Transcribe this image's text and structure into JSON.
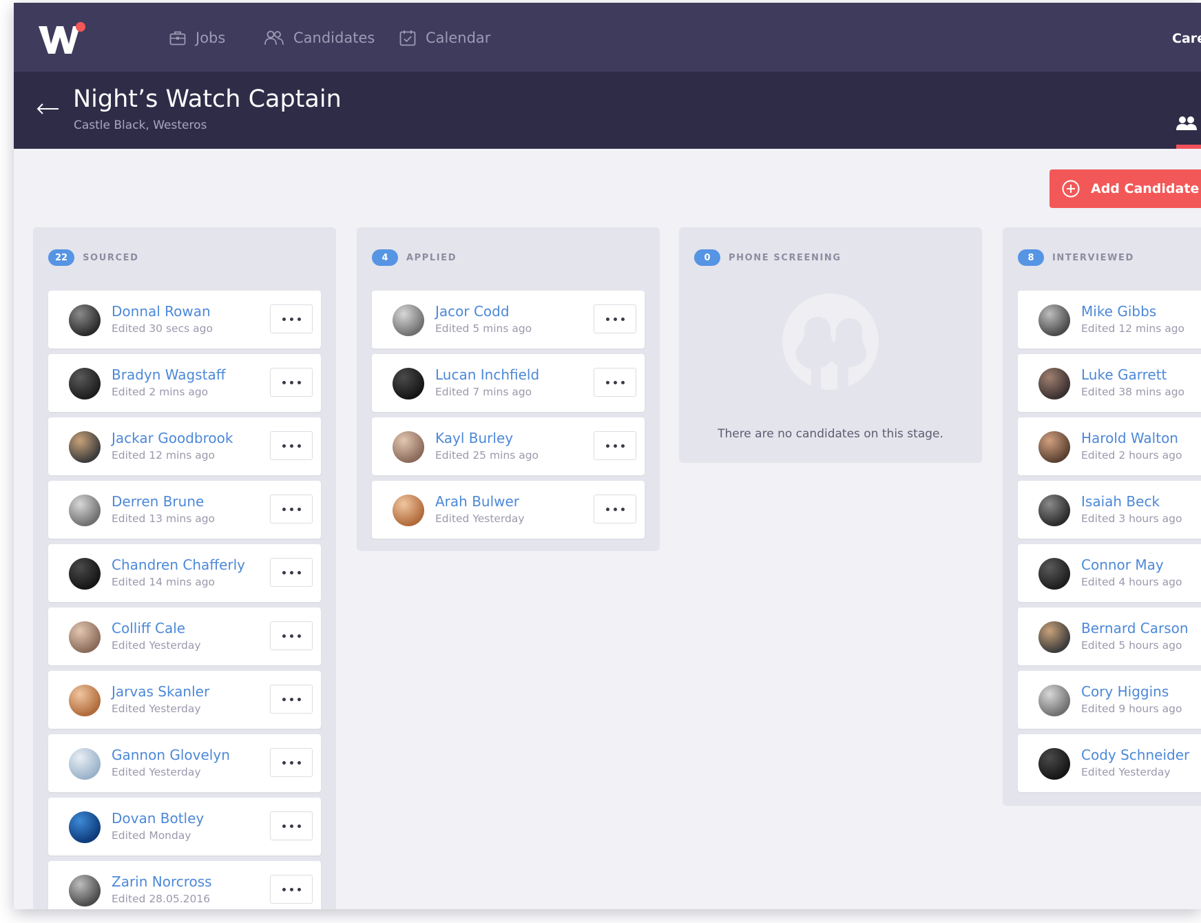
{
  "nav": {
    "items": [
      {
        "label": "Jobs",
        "icon": "briefcase-icon"
      },
      {
        "label": "Candidates",
        "icon": "users-icon"
      },
      {
        "label": "Calendar",
        "icon": "calendar-check-icon"
      }
    ],
    "right_label": "Care"
  },
  "job": {
    "title": "Night’s Watch Captain",
    "location": "Castle Black, Westeros"
  },
  "actions": {
    "add_candidate": "Add Candidate"
  },
  "colors": {
    "accent": "#f35858",
    "badge": "#5694e4",
    "link": "#4c88d8",
    "nav_bg": "#3e3b5c",
    "header_bg": "#2f2c48"
  },
  "columns": [
    {
      "name": "SOURCED",
      "count": "22",
      "candidates": [
        {
          "name": "Donnal Rowan",
          "edited": "Edited 30 secs ago"
        },
        {
          "name": "Bradyn Wagstaff",
          "edited": "Edited 2 mins ago"
        },
        {
          "name": "Jackar Goodbrook",
          "edited": "Edited 12 mins ago"
        },
        {
          "name": "Derren Brune",
          "edited": "Edited 13 mins ago"
        },
        {
          "name": "Chandren Chafferly",
          "edited": "Edited 14 mins ago"
        },
        {
          "name": "Colliff Cale",
          "edited": "Edited Yesterday"
        },
        {
          "name": "Jarvas Skanler",
          "edited": "Edited Yesterday"
        },
        {
          "name": "Gannon Glovelyn",
          "edited": "Edited Yesterday"
        },
        {
          "name": "Dovan Botley",
          "edited": "Edited Monday"
        },
        {
          "name": "Zarin Norcross",
          "edited": "Edited 28.05.2016"
        }
      ]
    },
    {
      "name": "APPLIED",
      "count": "4",
      "candidates": [
        {
          "name": "Jacor Codd",
          "edited": "Edited 5 mins ago"
        },
        {
          "name": "Lucan Inchfield",
          "edited": "Edited 7 mins ago"
        },
        {
          "name": "Kayl Burley",
          "edited": "Edited 25 mins ago"
        },
        {
          "name": "Arah Bulwer",
          "edited": "Edited Yesterday"
        }
      ]
    },
    {
      "name": "PHONE SCREENING",
      "count": "0",
      "empty_text": "There are no candidates on this stage.",
      "candidates": []
    },
    {
      "name": "INTERVIEWED",
      "count": "8",
      "candidates": [
        {
          "name": "Mike Gibbs",
          "edited": "Edited 12 mins ago"
        },
        {
          "name": "Luke Garrett",
          "edited": "Edited 38 mins ago"
        },
        {
          "name": "Harold Walton",
          "edited": "Edited 2 hours ago"
        },
        {
          "name": "Isaiah Beck",
          "edited": "Edited 3 hours ago"
        },
        {
          "name": "Connor May",
          "edited": "Edited 4 hours ago"
        },
        {
          "name": "Bernard Carson",
          "edited": "Edited 5 hours ago"
        },
        {
          "name": "Cory Higgins",
          "edited": "Edited 9 hours ago"
        },
        {
          "name": "Cody Schneider",
          "edited": "Edited Yesterday"
        }
      ]
    }
  ]
}
